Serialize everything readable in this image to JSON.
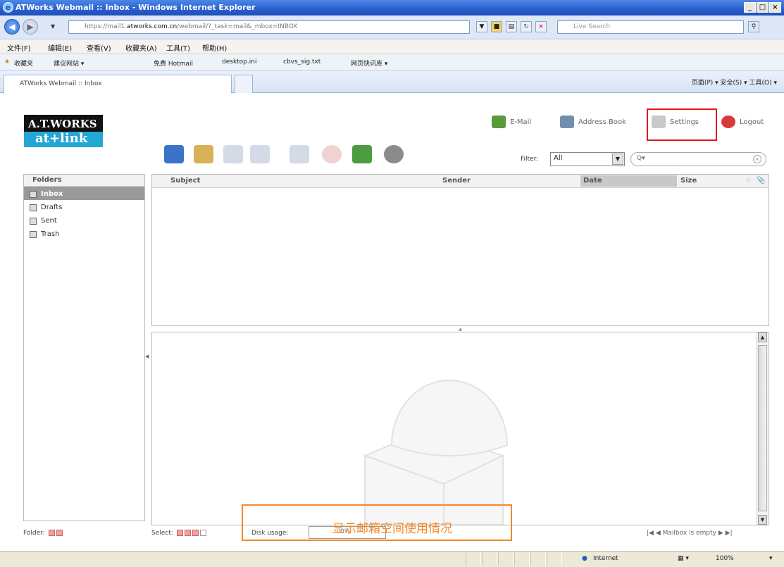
{
  "window": {
    "title": "ATWorks Webmail :: Inbox - Windows Internet Explorer",
    "buttons": [
      "_",
      "□",
      "×"
    ]
  },
  "addressbar": {
    "url_prefix": "https://mail1.",
    "url_domain": "atworks.com.cn",
    "url_rest": "/webmail/?_task=mail&_mbox=INBOX",
    "live_search_placeholder": "Live Search"
  },
  "menubar": [
    "文件(F)",
    "编辑(E)",
    "查看(V)",
    "收藏夹(A)",
    "工具(T)",
    "帮助(H)"
  ],
  "favbar": {
    "items": [
      "收藏夹",
      "建议网站 ▾",
      "免费 Hotmail",
      "desktop.ini",
      "cbvs_sig.txt",
      "网页快讯库 ▾"
    ]
  },
  "tabbar": {
    "active_tab": "ATWorks Webmail :: Inbox",
    "command_bar": "页面(P) ▾   安全(S) ▾   工具(O) ▾"
  },
  "webmail": {
    "logo_line1": "A.T.WORKS",
    "logo_line2": "at+link",
    "topnav": {
      "email": "E-Mail",
      "address_book": "Address Book",
      "settings": "Settings",
      "logout": "Logout"
    },
    "toolbar_icons": [
      "refresh-icon",
      "compose-icon",
      "reply-icon",
      "reply-all-icon",
      "forward-icon",
      "delete-icon",
      "mark-icon",
      "actions-gear-icon"
    ],
    "filter": {
      "label": "Filter:",
      "selected": "All"
    },
    "search": {
      "placeholder": "Q▾"
    },
    "folders": {
      "header": "Folders",
      "items": [
        "Inbox",
        "Drafts",
        "Sent",
        "Trash"
      ]
    },
    "message_list": {
      "columns": {
        "subject": "Subject",
        "sender": "Sender",
        "date": "Date",
        "size": "Size"
      }
    },
    "footer": {
      "folder_label": "Folder:",
      "select_label": "Select:",
      "disk_label": "Disk usage:",
      "disk_value": "0%",
      "mailbox_status": "Mailbox is empty",
      "annotation": "显示邮箱空间使用情况"
    }
  },
  "statusbar": {
    "zone": "Internet",
    "zoom": "100%"
  },
  "colors": {
    "highlight_red": "#e8141c",
    "highlight_orange": "#f08a2c",
    "logo_blue": "#23a7d4"
  }
}
